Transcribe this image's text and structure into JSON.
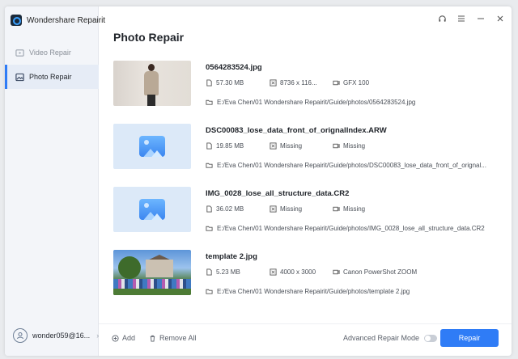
{
  "app": {
    "name": "Wondershare Repairit"
  },
  "sidebar": {
    "items": [
      {
        "label": "Video Repair",
        "icon": "video-repair-icon"
      },
      {
        "label": "Photo Repair",
        "icon": "photo-repair-icon"
      }
    ],
    "user": {
      "name": "wonder059@16..."
    }
  },
  "header": {
    "title": "Photo Repair"
  },
  "files": [
    {
      "name": "0564283524.jpg",
      "size": "57.30 MB",
      "dimensions": "8736 x 116...",
      "camera": "GFX 100",
      "path": "E:/Eva Chen/01 Wondershare Repairit/Guide/photos/0564283524.jpg"
    },
    {
      "name": "DSC00083_lose_data_front_of_orignalIndex.ARW",
      "size": "19.85 MB",
      "dimensions": "Missing",
      "camera": "Missing",
      "path": "E:/Eva Chen/01 Wondershare Repairit/Guide/photos/DSC00083_lose_data_front_of_orignal..."
    },
    {
      "name": "IMG_0028_lose_all_structure_data.CR2",
      "size": "36.02 MB",
      "dimensions": "Missing",
      "camera": "Missing",
      "path": "E:/Eva Chen/01 Wondershare Repairit/Guide/photos/IMG_0028_lose_all_structure_data.CR2"
    },
    {
      "name": "template 2.jpg",
      "size": "5.23 MB",
      "dimensions": "4000 x 3000",
      "camera": "Canon PowerShot ZOOM",
      "path": "E:/Eva Chen/01 Wondershare Repairit/Guide/photos/template 2.jpg"
    }
  ],
  "footer": {
    "add_label": "Add",
    "remove_all_label": "Remove All",
    "advanced_label": "Advanced Repair Mode",
    "repair_label": "Repair"
  },
  "colors": {
    "accent": "#2f7cf6",
    "sidebar_bg": "#f3f5f9"
  }
}
